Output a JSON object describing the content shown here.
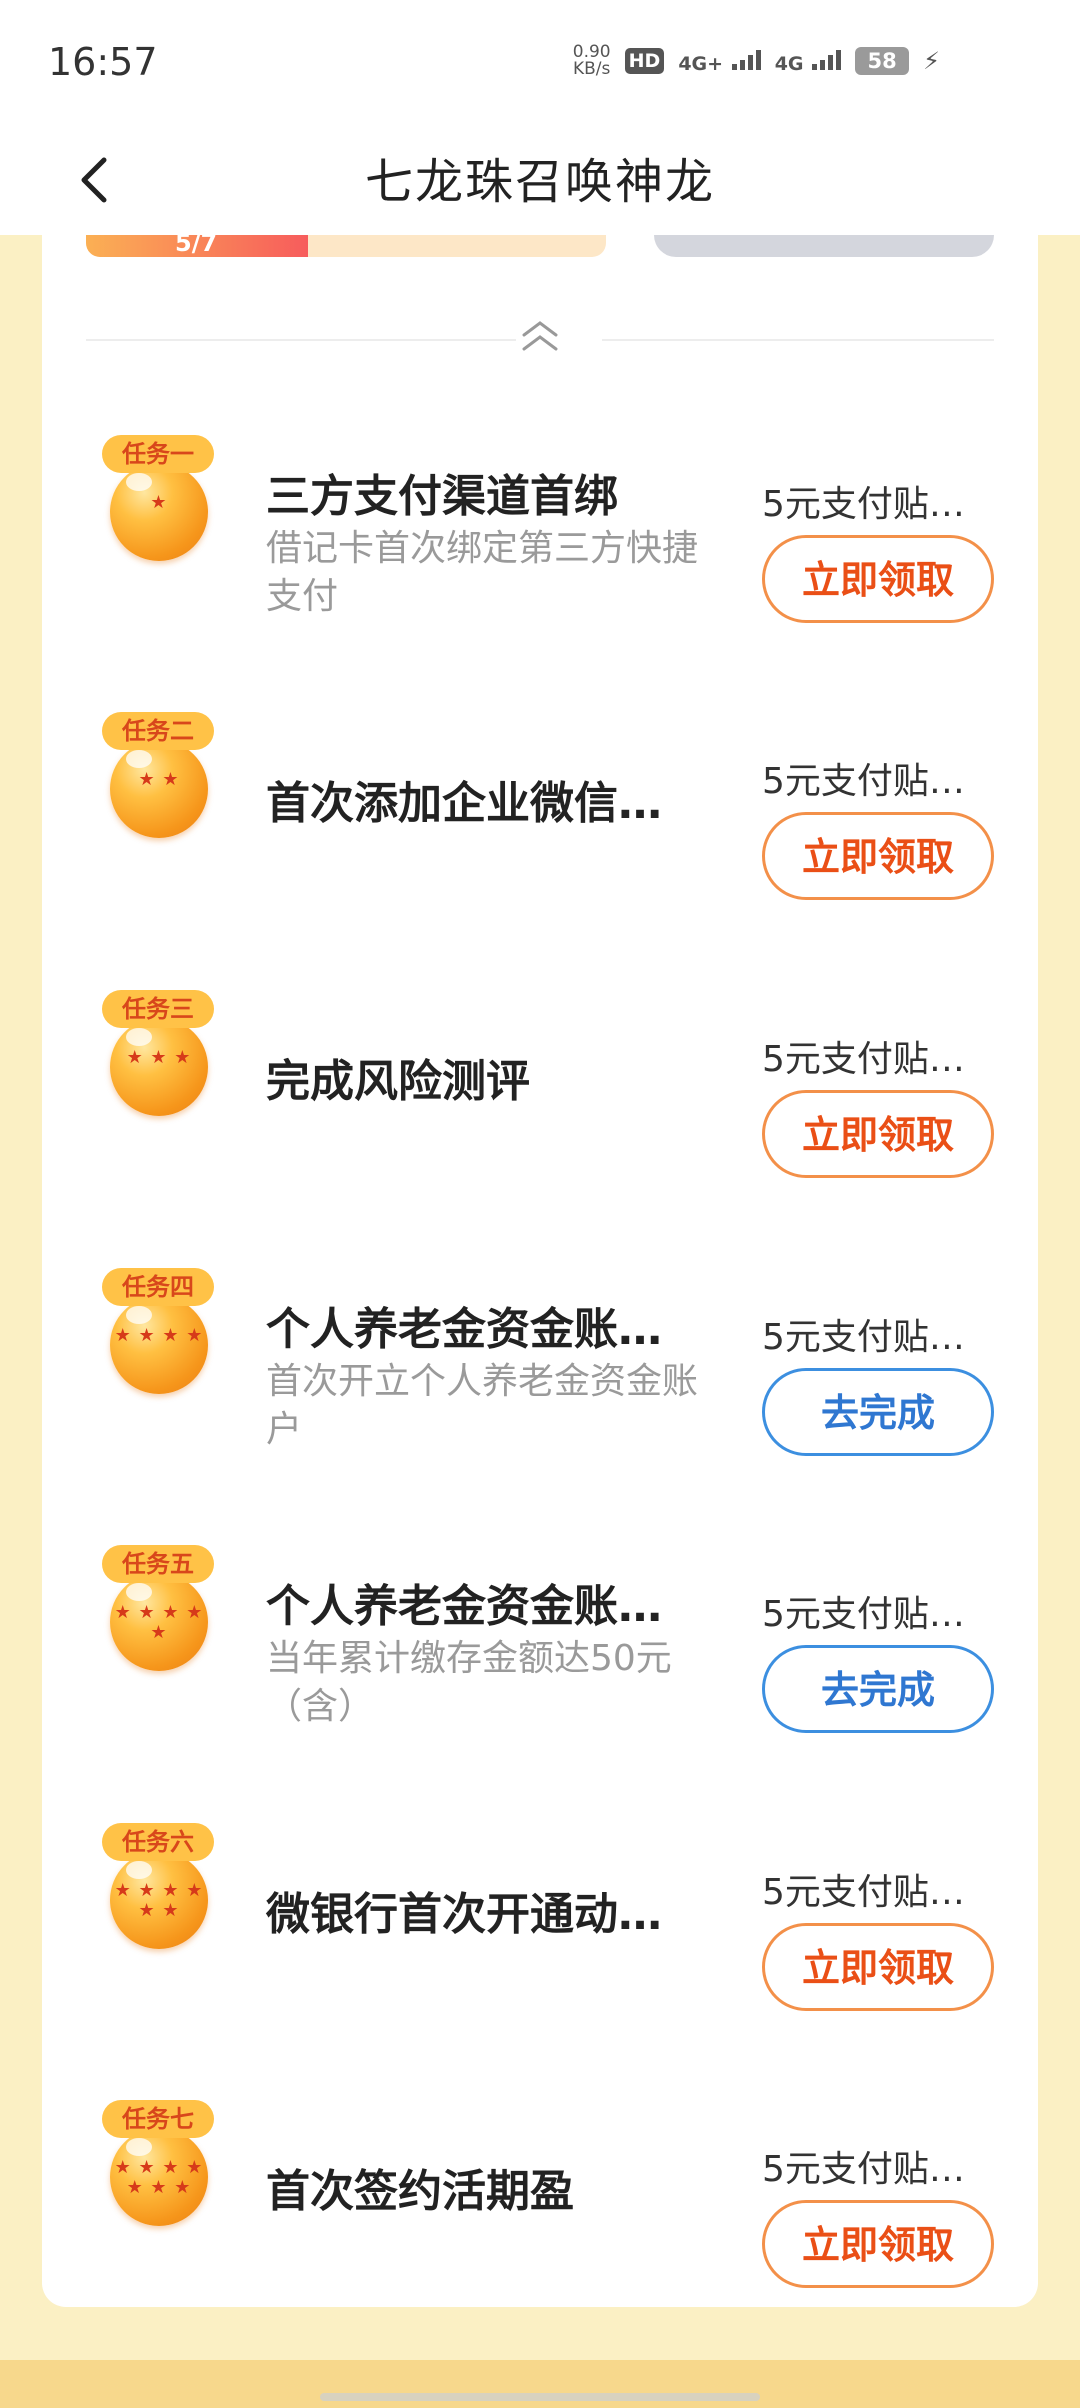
{
  "status": {
    "time": "16:57",
    "speed_value": "0.90",
    "speed_unit": "KB/s",
    "hd": "HD",
    "sim1": "4G+",
    "sim2": "4G",
    "battery": "58"
  },
  "nav": {
    "title": "七龙珠召唤神龙"
  },
  "progress": {
    "text": "5/7",
    "fraction": 0.71
  },
  "tasks": [
    {
      "badge": "任务一",
      "stars": "★",
      "name": "三方支付渠道首绑",
      "desc": "借记卡首次绑定第三方快捷支付",
      "reward": "5元支付贴…",
      "button": "立即领取",
      "type": "claim"
    },
    {
      "badge": "任务二",
      "stars": "★ ★",
      "name": "首次添加企业微信…",
      "desc": "",
      "reward": "5元支付贴…",
      "button": "立即领取",
      "type": "claim"
    },
    {
      "badge": "任务三",
      "stars": "★ ★ ★",
      "name": "完成风险测评",
      "desc": "",
      "reward": "5元支付贴…",
      "button": "立即领取",
      "type": "claim"
    },
    {
      "badge": "任务四",
      "stars": "★ ★ ★ ★",
      "name": "个人养老金资金账…",
      "desc": "首次开立个人养老金资金账户",
      "reward": "5元支付贴…",
      "button": "去完成",
      "type": "go"
    },
    {
      "badge": "任务五",
      "stars": "★ ★ ★ ★ ★",
      "name": "个人养老金资金账…",
      "desc": "当年累计缴存金额达50元（含）",
      "reward": "5元支付贴…",
      "button": "去完成",
      "type": "go"
    },
    {
      "badge": "任务六",
      "stars": "★ ★ ★ ★ ★ ★",
      "name": "微银行首次开通动…",
      "desc": "",
      "reward": "5元支付贴…",
      "button": "立即领取",
      "type": "claim"
    },
    {
      "badge": "任务七",
      "stars": "★ ★ ★ ★ ★ ★ ★",
      "name": "首次签约活期盈",
      "desc": "",
      "reward": "5元支付贴…",
      "button": "立即领取",
      "type": "claim"
    }
  ]
}
